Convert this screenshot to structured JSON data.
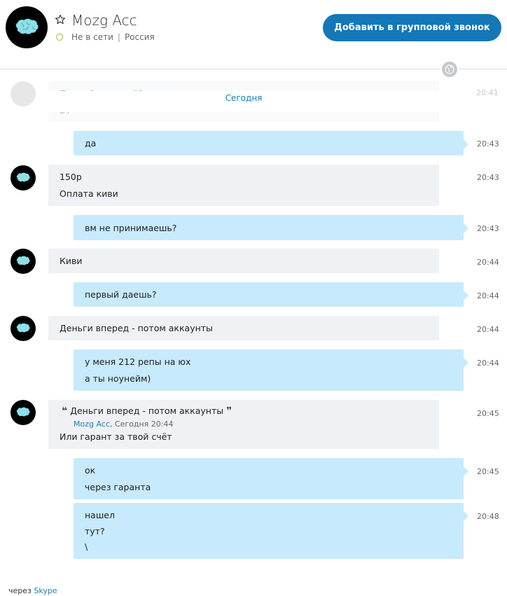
{
  "header": {
    "contact_name": "Mozg Acc",
    "status": "Не в сети",
    "country": "Россия",
    "add_call_button": "Добавить в групповой звонок",
    "star_icon": "star-outline-icon",
    "globe_icon": "globe-icon"
  },
  "date_separator": "Сегодня",
  "partial_message": {
    "line1": "Первый и второй?",
    "line2": "Эт",
    "time": "20:41"
  },
  "messages": [
    {
      "lines": [
        "да"
      ],
      "time": "20:43"
    },
    {
      "lines": [
        "150р",
        "Оплата киви"
      ],
      "time": "20:43"
    },
    {
      "lines": [
        "вм не принимаешь?"
      ],
      "time": "20:43"
    },
    {
      "lines": [
        "Киви"
      ],
      "time": "20:44"
    },
    {
      "lines": [
        "первый даешь?"
      ],
      "time": "20:44"
    },
    {
      "lines": [
        "Деньги вперед - потом аккаунты"
      ],
      "time": "20:44"
    },
    {
      "lines": [
        "у меня 212 репы на юх",
        "а ты ноунейм)"
      ],
      "time": "20:44"
    },
    {
      "quote": {
        "text": "Деньги вперед - потом аккаунты",
        "author": "Mozg Acc",
        "meta": ", Сегодня 20:44"
      },
      "lines": [
        "Или гарант за твой счёт"
      ],
      "time": "20:45"
    },
    {
      "lines": [
        "ок",
        "через гаранта"
      ],
      "time": "20:45"
    },
    {
      "lines": [
        "нашел",
        "тут?",
        "\\"
      ],
      "time": "20:48"
    }
  ],
  "footer": {
    "prefix": "через",
    "link": "Skype"
  },
  "colors": {
    "accent": "#1477b8",
    "outgoing": "#c7eafc",
    "incoming": "#f0f1f4",
    "online_ring": "#97c11e"
  }
}
